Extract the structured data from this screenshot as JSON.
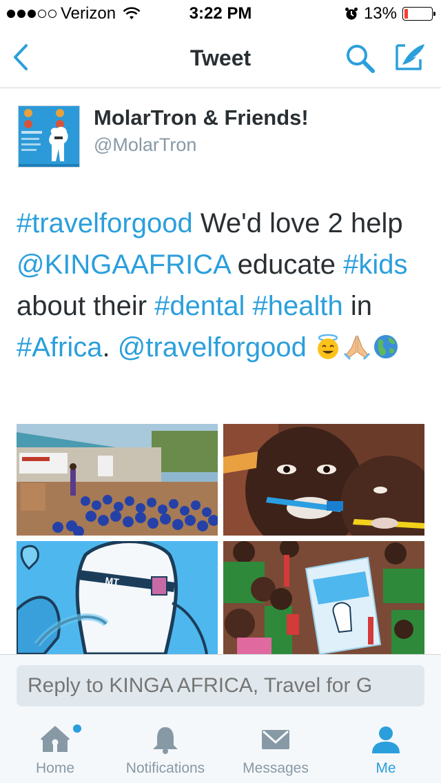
{
  "status_bar": {
    "carrier": "Verizon",
    "time": "3:22 PM",
    "battery": "13%",
    "signal_bars": 3,
    "battery_level": 0.13
  },
  "nav": {
    "title": "Tweet"
  },
  "tweet": {
    "author_name": "MolarTron & Friends!",
    "author_handle": "@MolarTron",
    "text": {
      "t1": "#travelforgood",
      "t2": " We'd love 2 help ",
      "t3": "@KINGAAFRICA",
      "t4": " educate ",
      "t5": "#kids",
      "t6": " about their ",
      "t7": "#dental",
      "t8": " ",
      "t9": "#health",
      "t10": " in ",
      "t11": "#Africa",
      "t12": ". ",
      "t13": "@travelforgood",
      "t14": " "
    },
    "emojis": [
      "smiling-face-with-halo-icon",
      "folded-hands-icon",
      "globe-icon"
    ]
  },
  "reply": {
    "placeholder": "Reply to KINGA AFRICA, Travel for G"
  },
  "tabs": [
    {
      "label": "Home",
      "icon": "home-icon",
      "has_badge": true
    },
    {
      "label": "Notifications",
      "icon": "bell-icon"
    },
    {
      "label": "Messages",
      "icon": "envelope-icon"
    },
    {
      "label": "Me",
      "icon": "person-icon",
      "active": true
    }
  ],
  "colors": {
    "accent": "#2b9fdc",
    "text": "#292f33",
    "muted": "#8899a6",
    "battery_low": "#ff3b30"
  }
}
